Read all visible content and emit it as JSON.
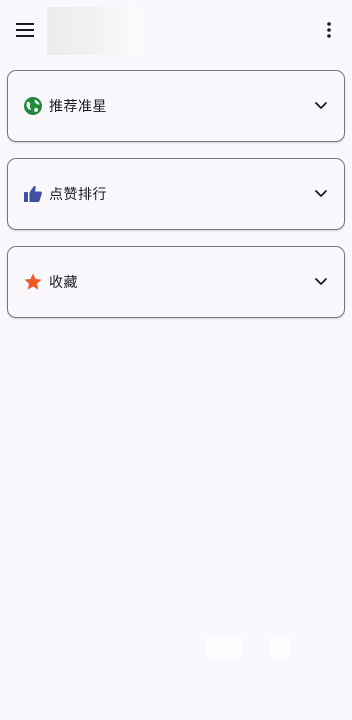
{
  "app_bar": {
    "menu_icon": "hamburger-menu-icon",
    "more_icon": "more-vert-icon"
  },
  "sections": [
    {
      "label": "推荐准星",
      "icon": "globe-icon",
      "icon_color": "#1f8a3b",
      "expanded": false
    },
    {
      "label": "点赞排行",
      "icon": "thumb-up-icon",
      "icon_color": "#3f4fa3",
      "expanded": false
    },
    {
      "label": "收藏",
      "icon": "star-icon",
      "icon_color": "#f05a28",
      "expanded": false
    }
  ],
  "colors": {
    "background": "#fbf8fd",
    "card_border": "#7a7680",
    "text": "#1b1b1f"
  }
}
